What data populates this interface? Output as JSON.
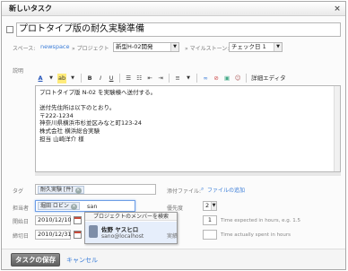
{
  "dialog": {
    "title": "新しいタスク",
    "close": "×"
  },
  "task": {
    "title_value": "プロトタイプ版の耐久実験準備"
  },
  "location": {
    "space_label": "スペース:",
    "space_name": "newspace",
    "project_label": "» プロジェクト",
    "project_value": "新型H-02開発",
    "milestone_label": "» マイルストーン:",
    "milestone_value": "チェック日 1"
  },
  "description": {
    "label": "説明",
    "toolbar": {
      "font_color": "A",
      "highlight": "ab",
      "bold": "B",
      "italic": "I",
      "underline": "U",
      "bullet_list": "☰",
      "number_list": "☷",
      "align": "≡",
      "html_editor": "詳細エディタ"
    },
    "lines": [
      "プロトタイプ版 N-02 を実験棟へ送付する。",
      "",
      "送付先住所は以下のとおり。",
      "〒222-1234",
      "神奈川県横浜市杉並区みなと町123-24",
      "株式会社 横浜総合実験",
      "担当 山崎洋介 様"
    ]
  },
  "tags": {
    "label": "タグ",
    "chip": "耐久実験 [件]",
    "attach_label": "添付ファイル:",
    "attach_link": "ファイルの追加"
  },
  "assignee": {
    "label": "担当者",
    "chip": "堀田 ロビン",
    "query": "san",
    "dropdown_header": "プロジェクトのメンバーを検索",
    "suggestion_name": "佐野 ヤスヒロ",
    "suggestion_email": "sano@localhost"
  },
  "priority": {
    "label": "優先度",
    "value": "2"
  },
  "dates": {
    "start_label": "開始日",
    "start_value": "2010/12/10",
    "due_label": "締切日",
    "due_value": "2010/12/31"
  },
  "estimates": {
    "expected_value": "1",
    "expected_hint": "Time expected in hours, e.g. 1.5",
    "actual_label": "実績",
    "actual_value": "",
    "actual_hint": "Time actually spent in hours"
  },
  "footer": {
    "save": "タスクの保存",
    "cancel": "キャンセル"
  }
}
